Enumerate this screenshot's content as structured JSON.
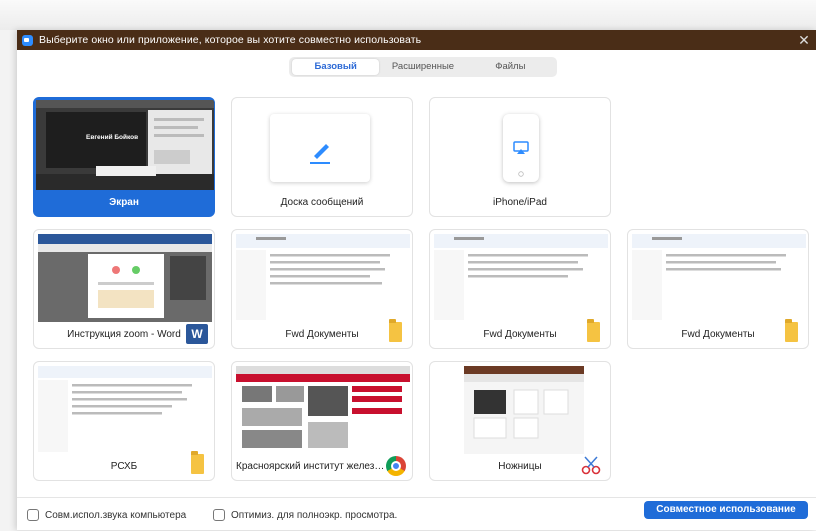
{
  "window": {
    "title": "Выберите окно или приложение, которое вы хотите совместно использовать",
    "close_glyph": "✕"
  },
  "tabs": [
    {
      "label": "Базовый",
      "active": true
    },
    {
      "label": "Расширенные",
      "active": false
    },
    {
      "label": "Файлы",
      "active": false
    }
  ],
  "cards": {
    "screen": {
      "label": "Экран",
      "selected": true,
      "thumb_text": "Евгений Бойков"
    },
    "whiteboard": {
      "label": "Доска сообщений"
    },
    "iphone": {
      "label": "iPhone/iPad"
    },
    "word": {
      "label": "Инструкция zoom - Word",
      "badge": "W"
    },
    "fwd1": {
      "label": "Fwd Документы"
    },
    "fwd2": {
      "label": "Fwd Документы"
    },
    "fwd3": {
      "label": "Fwd Документы"
    },
    "pcxb": {
      "label": "РСХБ"
    },
    "chrome": {
      "label": "Красноярский институт железн..."
    },
    "scissors": {
      "label": "Ножницы"
    }
  },
  "bottom": {
    "share_sound": "Совм.испол.звука компьютера",
    "optimize": "Оптимиз. для полноэкр. просмотра.",
    "share_button": "Совместное использование"
  },
  "colors": {
    "accent": "#1f6cd8",
    "titlebar": "#4a2d17"
  }
}
